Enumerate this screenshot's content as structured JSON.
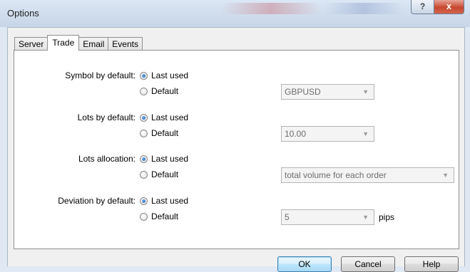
{
  "window": {
    "title": "Options",
    "help_glyph": "?",
    "close_glyph": "x"
  },
  "tabs": [
    {
      "label": "Server",
      "active": false
    },
    {
      "label": "Trade",
      "active": true
    },
    {
      "label": "Email",
      "active": false
    },
    {
      "label": "Events",
      "active": false
    }
  ],
  "settings": {
    "symbol": {
      "label": "Symbol by default:",
      "option_last": "Last used",
      "option_default": "Default",
      "selected": "Last used",
      "value": "GBPUSD"
    },
    "lots": {
      "label": "Lots by default:",
      "option_last": "Last used",
      "option_default": "Default",
      "selected": "Last used",
      "value": "10.00"
    },
    "allocation": {
      "label": "Lots allocation:",
      "option_last": "Last used",
      "option_default": "Default",
      "selected": "Last used",
      "value": "total volume for each order"
    },
    "deviation": {
      "label": "Deviation by default:",
      "option_last": "Last used",
      "option_default": "Default",
      "selected": "Last used",
      "value": "5",
      "unit": "pips"
    }
  },
  "buttons": {
    "ok": "OK",
    "cancel": "Cancel",
    "help": "Help"
  },
  "icons": {
    "dropdown": "chevron-down-icon",
    "radio_checked": "radio-checked-icon",
    "radio_unchecked": "radio-unchecked-icon"
  },
  "colors": {
    "accent": "#1c5aa6",
    "close_button": "#c7482f"
  }
}
